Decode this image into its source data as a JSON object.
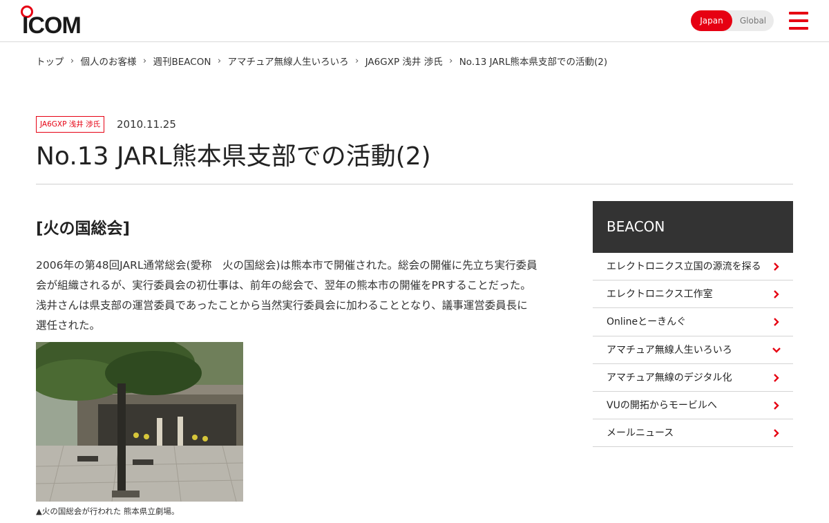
{
  "header": {
    "logo_text": "ICOM",
    "region": {
      "japan": "Japan",
      "global": "Global"
    },
    "brand_color": "#e60012"
  },
  "breadcrumb": [
    "トップ",
    "個人のお客様",
    "週刊BEACON",
    "アマチュア無線人生いろいろ",
    "JA6GXP 浅井 渉氏",
    "No.13 JARL熊本県支部での活動(2)"
  ],
  "article": {
    "tag": "JA6GXP 浅井 渉氏",
    "date": "2010.11.25",
    "title": "No.13 JARL熊本県支部での活動(2)",
    "section_heading": "[火の国総会]",
    "paragraph_lines": [
      "2006年の第48回JARL通常総会(愛称　火の国総会)は熊本市で開催された。総会の開催に先立ち実行委員",
      "会が組織されるが、実行委員会の初仕事は、前年の総会で、翌年の熊本市の開催をPRすることだった。",
      "浅井さんは県支部の運営委員であったことから当然実行委員会に加わることとなり、議事運営委員長に",
      "選任された。"
    ],
    "caption": "▲火の国総会が行われた 熊本県立劇場。"
  },
  "sidebar": {
    "title": "BEACON",
    "items": [
      {
        "label": "エレクトロニクス立国の源流を探る",
        "icon": "chevron-right-icon"
      },
      {
        "label": "エレクトロニクス工作室",
        "icon": "chevron-right-icon"
      },
      {
        "label": "Onlineとーきんぐ",
        "icon": "chevron-right-icon"
      },
      {
        "label": "アマチュア無線人生いろいろ",
        "icon": "chevron-down-icon"
      },
      {
        "label": "アマチュア無線のデジタル化",
        "icon": "chevron-right-icon"
      },
      {
        "label": "VUの開拓からモービルへ",
        "icon": "chevron-right-icon"
      },
      {
        "label": "メールニュース",
        "icon": "chevron-right-icon"
      }
    ]
  }
}
